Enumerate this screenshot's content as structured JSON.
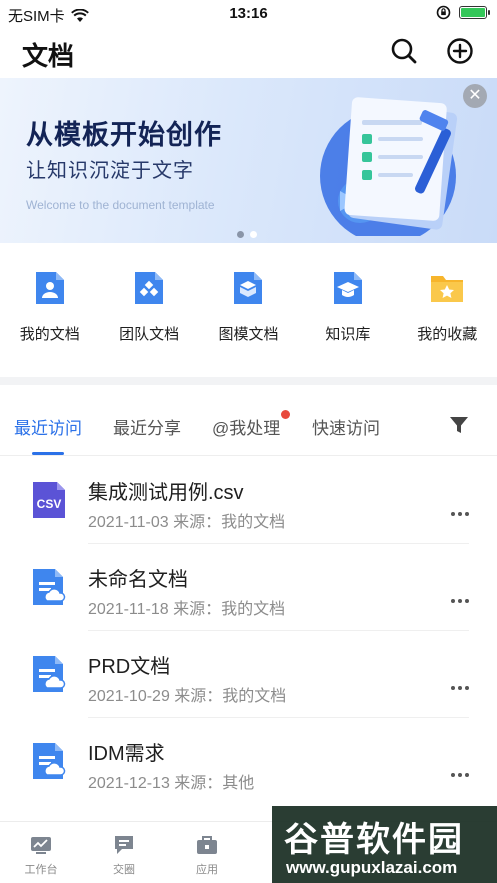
{
  "status_bar": {
    "carrier": "无SIM卡",
    "time": "13:16"
  },
  "header": {
    "title": "文档",
    "search_icon": "search-icon",
    "add_icon": "plus-circle-icon"
  },
  "banner": {
    "title": "从模板开始创作",
    "subtitle": "让知识沉淀于文字",
    "english": "Welcome to the document template",
    "close_icon": "close-icon",
    "slide_count": 2,
    "active_slide": 1
  },
  "entries": [
    {
      "label": "我的文档",
      "icon": "person-doc-icon"
    },
    {
      "label": "团队文档",
      "icon": "team-doc-icon"
    },
    {
      "label": "图模文档",
      "icon": "cube-doc-icon"
    },
    {
      "label": "知识库",
      "icon": "graduation-cap-icon"
    },
    {
      "label": "我的收藏",
      "icon": "star-folder-icon"
    }
  ],
  "tabs": [
    {
      "label": "最近访问",
      "active": true
    },
    {
      "label": "最近分享",
      "active": false
    },
    {
      "label": "@我处理",
      "active": false,
      "badge": true
    },
    {
      "label": "快速访问",
      "active": false
    }
  ],
  "files": [
    {
      "name": "集成测试用例.csv",
      "meta": "2021-11-03 来源：我的文档",
      "icon": "csv-file-icon"
    },
    {
      "name": "未命名文档",
      "meta": "2021-11-18 来源：我的文档",
      "icon": "cloud-doc-icon"
    },
    {
      "name": "PRD文档",
      "meta": "2021-10-29 来源：我的文档",
      "icon": "cloud-doc-icon"
    },
    {
      "name": "IDM需求",
      "meta": "2021-12-13 来源：其他",
      "icon": "cloud-doc-icon"
    }
  ],
  "csv_badge": "CSV",
  "bottom_nav": [
    {
      "label": "工作台",
      "icon": "workbench-icon"
    },
    {
      "label": "交圈",
      "icon": "chat-icon"
    },
    {
      "label": "应用",
      "icon": "briefcase-icon"
    }
  ],
  "watermark": {
    "title": "谷普软件园",
    "url": "www.gupuxlazai.com"
  },
  "colors": {
    "accent": "#2b71e8",
    "icon_blue": "#3f86ee",
    "star_yellow": "#f7b52c",
    "csv_purple": "#5b53d6",
    "badge_red": "#e84a3d"
  }
}
